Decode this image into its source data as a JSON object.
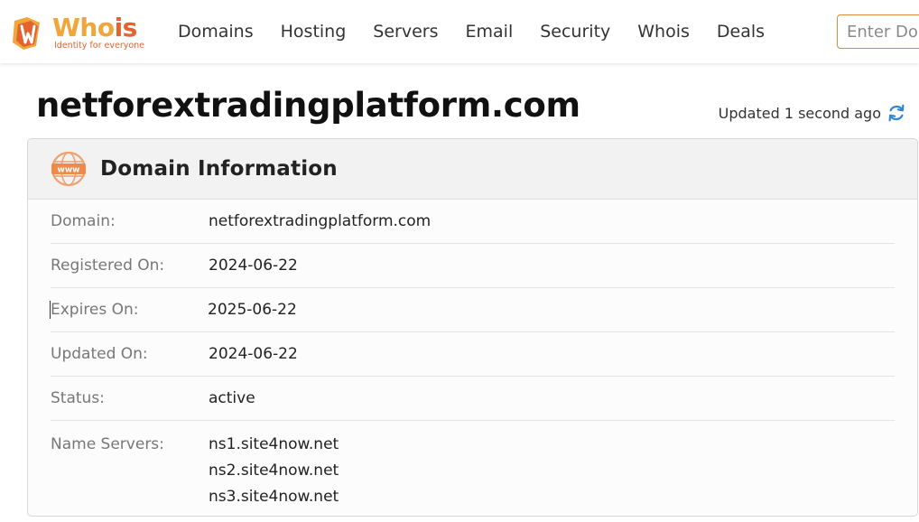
{
  "header": {
    "logo": {
      "word_part1": "Who",
      "word_part2": "is",
      "tagline": "Identity for everyone"
    },
    "nav": [
      "Domains",
      "Hosting",
      "Servers",
      "Email",
      "Security",
      "Whois",
      "Deals"
    ],
    "search": {
      "placeholder": "Enter Domain or IP",
      "value": ""
    }
  },
  "page": {
    "title": "netforextradingplatform.com",
    "updated_text": "Updated 1 second ago"
  },
  "domain_info": {
    "heading": "Domain Information",
    "rows": [
      {
        "label": "Domain:",
        "value": "netforextradingplatform.com"
      },
      {
        "label": "Registered On:",
        "value": "2024-06-22"
      },
      {
        "label": "Expires On:",
        "value": "2025-06-22"
      },
      {
        "label": "Updated On:",
        "value": "2024-06-22"
      },
      {
        "label": "Status:",
        "value": "active"
      }
    ],
    "name_servers": {
      "label": "Name Servers:",
      "values": [
        "ns1.site4now.net",
        "ns2.site4now.net",
        "ns3.site4now.net"
      ]
    }
  },
  "colors": {
    "brand_orange": "#e2632e",
    "brand_yellow": "#f0a63a",
    "refresh_blue": "#2f86d6"
  },
  "icons": [
    "whois-logo-icon",
    "refresh-icon",
    "www-globe-icon"
  ]
}
